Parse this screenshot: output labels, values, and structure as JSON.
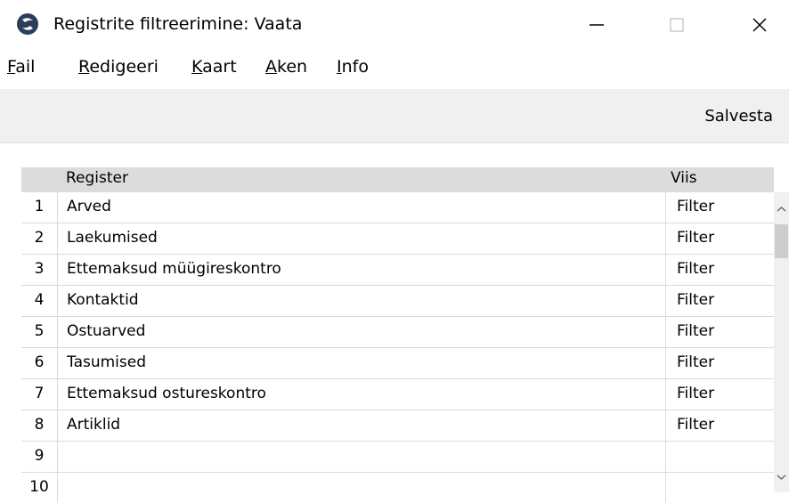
{
  "window": {
    "title": "Registrite filtreerimine: Vaata"
  },
  "menubar": {
    "items": [
      {
        "mnemonic": "F",
        "rest": "ail"
      },
      {
        "mnemonic": "R",
        "rest": "edigeeri"
      },
      {
        "mnemonic": "K",
        "rest": "aart"
      },
      {
        "mnemonic": "A",
        "rest": "ken"
      },
      {
        "mnemonic": "I",
        "rest": "nfo"
      }
    ]
  },
  "toolbar": {
    "save_label": "Salvesta"
  },
  "grid": {
    "columns": {
      "register": "Register",
      "viis": "Viis"
    },
    "rows": [
      {
        "num": "1",
        "register": "Arved",
        "viis": "Filter"
      },
      {
        "num": "2",
        "register": "Laekumised",
        "viis": "Filter"
      },
      {
        "num": "3",
        "register": "Ettemaksud müügireskontro",
        "viis": "Filter"
      },
      {
        "num": "4",
        "register": "Kontaktid",
        "viis": "Filter"
      },
      {
        "num": "5",
        "register": "Ostuarved",
        "viis": "Filter"
      },
      {
        "num": "6",
        "register": "Tasumised",
        "viis": "Filter"
      },
      {
        "num": "7",
        "register": "Ettemaksud ostureskontro",
        "viis": "Filter"
      },
      {
        "num": "8",
        "register": "Artiklid",
        "viis": "Filter"
      },
      {
        "num": "9",
        "register": "",
        "viis": ""
      },
      {
        "num": "10",
        "register": "",
        "viis": ""
      }
    ]
  }
}
